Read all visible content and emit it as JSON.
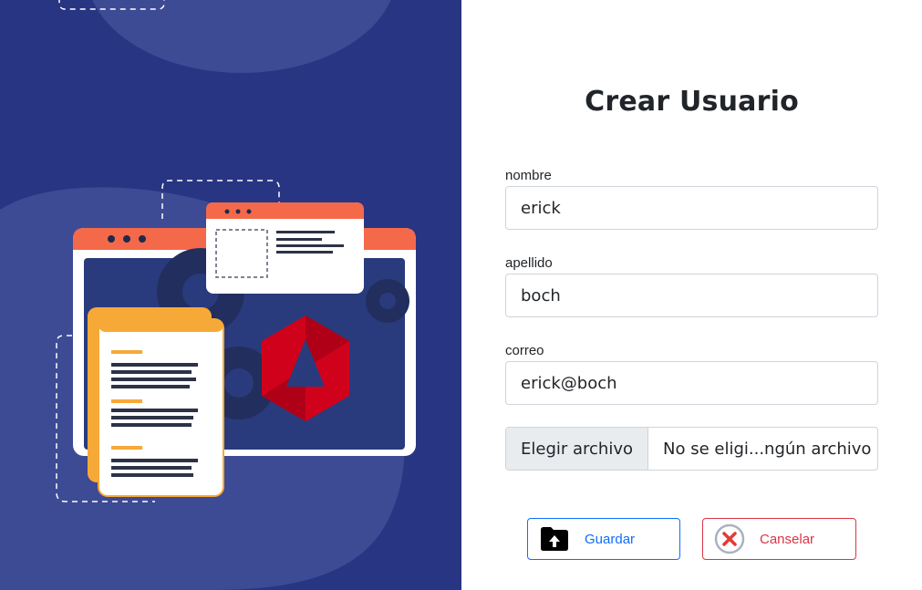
{
  "form": {
    "title": "Crear Usuario",
    "fields": [
      {
        "label": "nombre",
        "value": "erick"
      },
      {
        "label": "apellido",
        "value": "boch"
      },
      {
        "label": "correo",
        "value": "erick@boch"
      }
    ],
    "file": {
      "button_label": "Elegir archivo",
      "file_name": "No se eligi...ngún archivo"
    }
  },
  "actions": {
    "save": {
      "label": "Guardar",
      "icon": "folder-upload-icon",
      "color": "#0d6efd"
    },
    "cancel": {
      "label": "Canselar",
      "icon": "close-circle-icon",
      "color": "#dc3545"
    }
  },
  "illustration": {
    "background_color": "#283583",
    "accent_color": "#f4694a",
    "logo_color": "#d0021b"
  }
}
